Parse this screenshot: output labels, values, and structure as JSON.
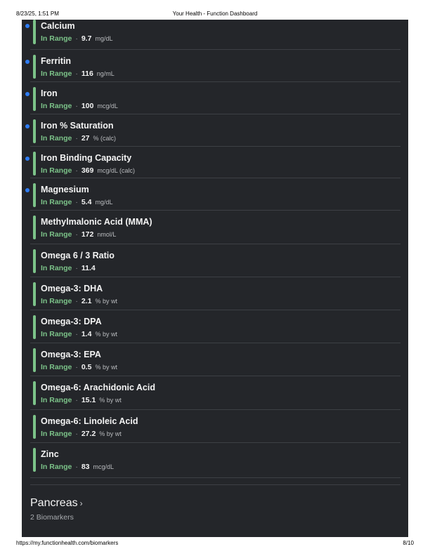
{
  "print": {
    "date": "8/23/25, 1:51 PM",
    "title": "Your Health - Function Dashboard",
    "url": "https://my.functionhealth.com/biomarkers",
    "page": "8/10"
  },
  "colors": {
    "panel_bg": "#24262a",
    "in_range": "#7cc389",
    "new_dot": "#2f7df6"
  },
  "biomarkers": [
    {
      "name": "Calcium",
      "status": "In Range",
      "value": "9.7",
      "unit": "mg/dL",
      "new": true
    },
    {
      "name": "Ferritin",
      "status": "In Range",
      "value": "116",
      "unit": "ng/mL",
      "new": true
    },
    {
      "name": "Iron",
      "status": "In Range",
      "value": "100",
      "unit": "mcg/dL",
      "new": true
    },
    {
      "name": "Iron % Saturation",
      "status": "In Range",
      "value": "27",
      "unit": "% (calc)",
      "new": true
    },
    {
      "name": "Iron Binding Capacity",
      "status": "In Range",
      "value": "369",
      "unit": "mcg/dL (calc)",
      "new": true
    },
    {
      "name": "Magnesium",
      "status": "In Range",
      "value": "5.4",
      "unit": "mg/dL",
      "new": true
    },
    {
      "name": "Methylmalonic Acid (MMA)",
      "status": "In Range",
      "value": "172",
      "unit": "nmol/L",
      "new": false
    },
    {
      "name": "Omega 6 / 3 Ratio",
      "status": "In Range",
      "value": "11.4",
      "unit": "",
      "new": false
    },
    {
      "name": "Omega-3: DHA",
      "status": "In Range",
      "value": "2.1",
      "unit": "% by wt",
      "new": false
    },
    {
      "name": "Omega-3: DPA",
      "status": "In Range",
      "value": "1.4",
      "unit": "% by wt",
      "new": false
    },
    {
      "name": "Omega-3: EPA",
      "status": "In Range",
      "value": "0.5",
      "unit": "% by wt",
      "new": false
    },
    {
      "name": "Omega-6: Arachidonic Acid",
      "status": "In Range",
      "value": "15.1",
      "unit": "% by wt",
      "new": false
    },
    {
      "name": "Omega-6: Linoleic Acid",
      "status": "In Range",
      "value": "27.2",
      "unit": "% by wt",
      "new": false
    },
    {
      "name": "Zinc",
      "status": "In Range",
      "value": "83",
      "unit": "mcg/dL",
      "new": false
    }
  ],
  "next_section": {
    "title": "Pancreas",
    "chevron": "›",
    "count": "2 Biomarkers"
  }
}
